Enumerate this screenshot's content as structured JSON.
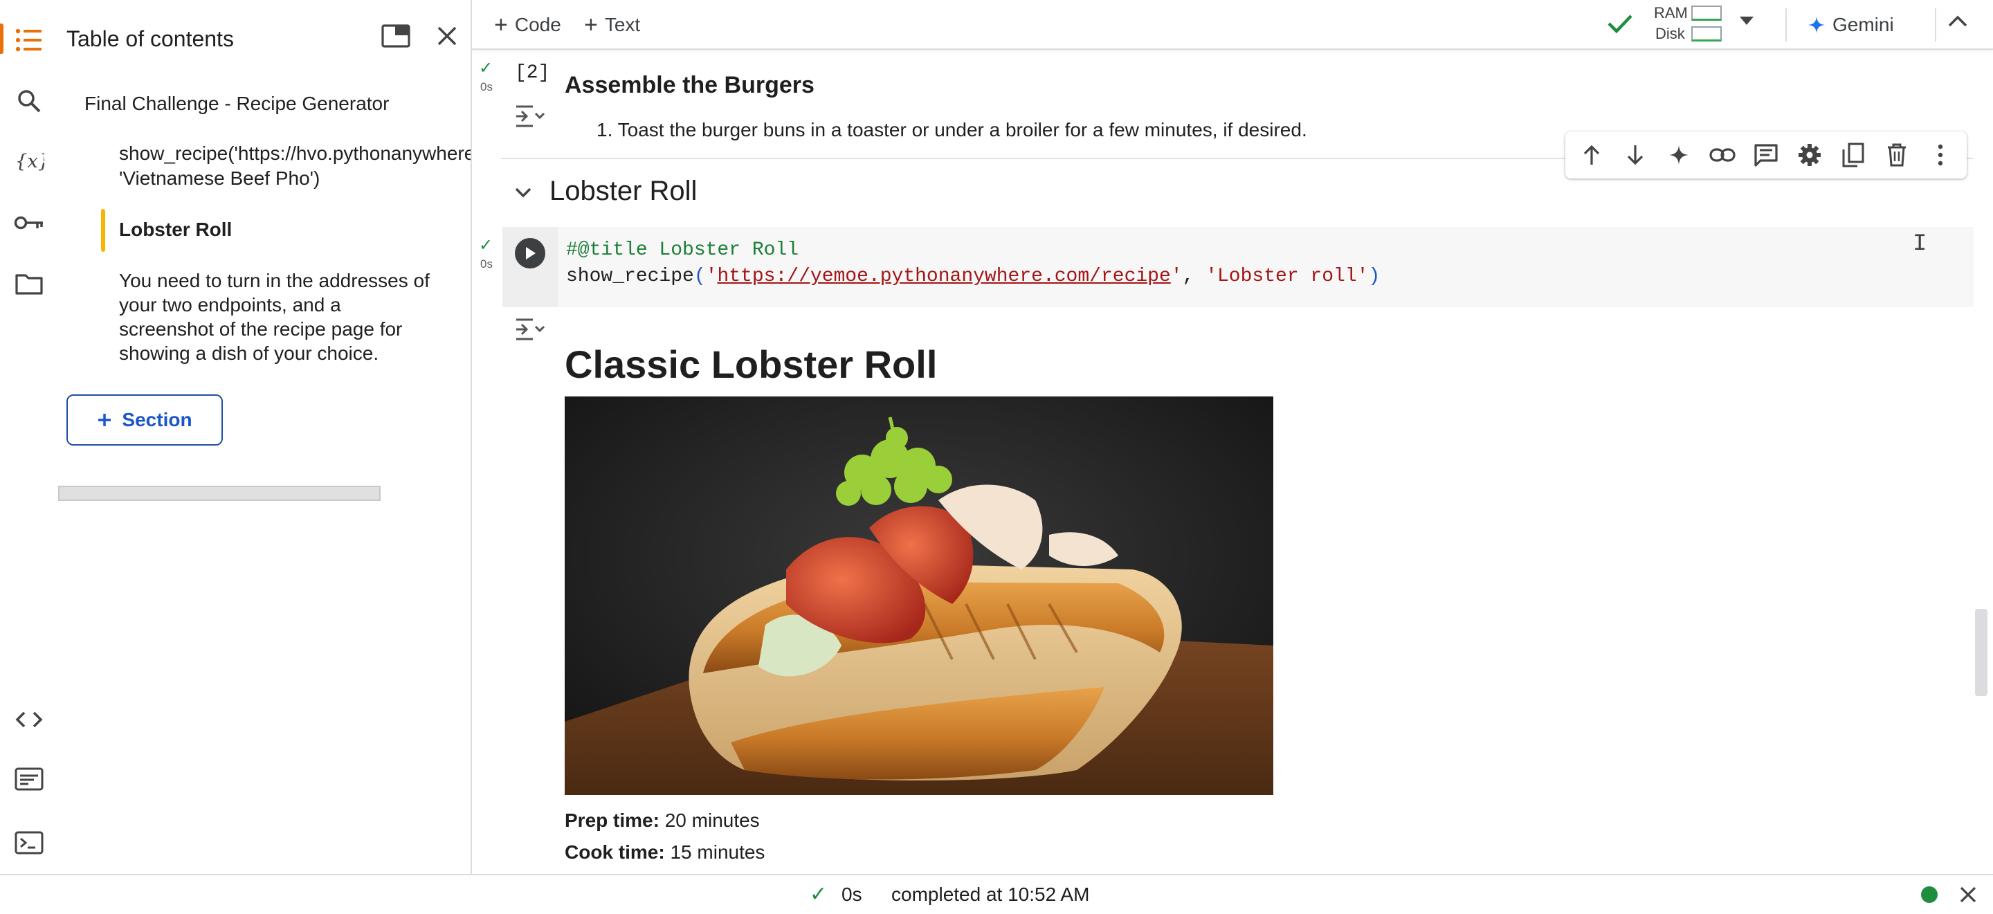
{
  "rail": {
    "icons": [
      "table-of-contents-icon",
      "search-icon",
      "variables-icon",
      "secrets-key-icon",
      "files-folder-icon",
      "code-snippets-icon",
      "command-palette-icon",
      "terminal-icon"
    ]
  },
  "toc": {
    "title": "Table of contents",
    "items": [
      {
        "label": "Final Challenge - Recipe Generator"
      },
      {
        "label": "show_recipe('https://hvo.pythonanywhere",
        "label2": "'Vietnamese Beef Pho')"
      },
      {
        "label": "Lobster Roll"
      },
      {
        "lines": [
          "You need to turn in the addresses of",
          "your two endpoints, and a",
          "screenshot of the recipe page for",
          "showing a dish of your choice."
        ]
      }
    ],
    "section_button": "Section"
  },
  "toolbar": {
    "code_label": "Code",
    "text_label": "Text",
    "ram_label": "RAM",
    "disk_label": "Disk",
    "gemini_label": "Gemini"
  },
  "cells": {
    "previous": {
      "exec_count": "[2]",
      "exec_time": "0s",
      "heading": "Assemble the Burgers",
      "step_number": "1.",
      "step_text": "Toast the burger buns in a toaster or under a broiler for a few minutes, if desired."
    },
    "section": {
      "title": "Lobster Roll"
    },
    "code": {
      "exec_time": "0s",
      "line1": "#@title Lobster Roll",
      "fn": "show_recipe",
      "url": "https://yemoe.pythonanywhere.com/recipe",
      "arg2": "'Lobster roll'"
    },
    "output": {
      "recipe_title": "Classic Lobster Roll",
      "prep_label": "Prep time:",
      "prep_value": "20 minutes",
      "cook_label": "Cook time:",
      "cook_value": "15 minutes"
    }
  },
  "status": {
    "time": "0s",
    "text": "completed at 10:52 AM"
  },
  "colors": {
    "accent_orange": "#e8710a",
    "toc_active": "#f6b400",
    "link_blue": "#1a56c8",
    "success_green": "#1e8e3e"
  }
}
